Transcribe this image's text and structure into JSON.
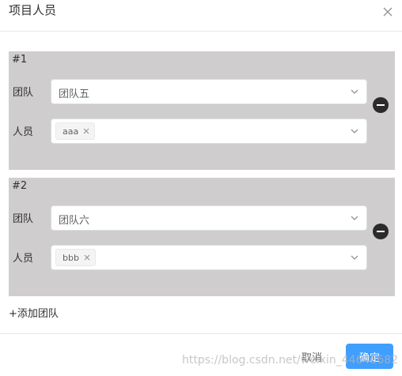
{
  "dialog": {
    "title": "项目人员",
    "close_icon": "close-icon"
  },
  "groups": [
    {
      "index": "#1",
      "team_label": "团队",
      "team_value": "团队五",
      "members_label": "人员",
      "member_tags": [
        "aaa"
      ]
    },
    {
      "index": "#2",
      "team_label": "团队",
      "team_value": "团队六",
      "members_label": "人员",
      "member_tags": [
        "bbb"
      ]
    }
  ],
  "add_team_label": "+添加团队",
  "footer": {
    "cancel_label": "取消",
    "confirm_label": "确定"
  },
  "watermark": "https://blog.csdn.net/weixin_44646682",
  "colors": {
    "group_background": "#cfcdcd",
    "primary": "#409eff",
    "remove_button": "#2b2b2b"
  }
}
